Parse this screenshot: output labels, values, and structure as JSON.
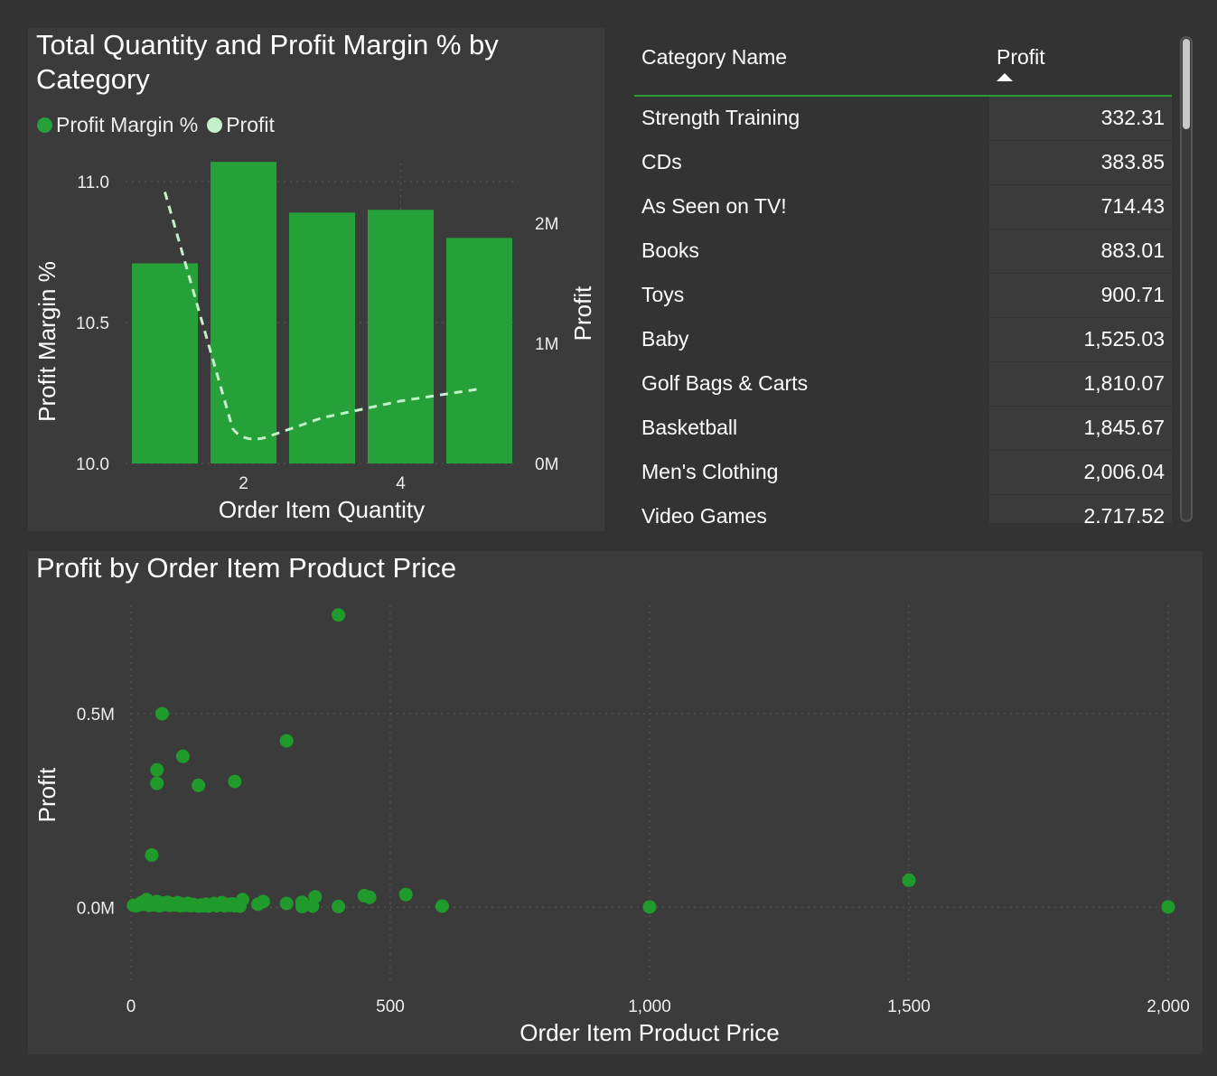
{
  "combo": {
    "title": "Total Quantity and Profit Margin % by Category",
    "legend": [
      {
        "label": "Profit Margin %",
        "color": "#26a038"
      },
      {
        "label": "Profit",
        "color": "#c4f0cc"
      }
    ],
    "chart_data": {
      "type": "bar",
      "title": "Total Quantity and Profit Margin % by Category",
      "xlabel": "Order Item Quantity",
      "ylabel": "Profit Margin %",
      "y2label": "Profit",
      "x": [
        1,
        2,
        3,
        4,
        5
      ],
      "x_ticks": [
        "2",
        "4"
      ],
      "y_ticks": [
        "10.0",
        "10.5",
        "11.0"
      ],
      "y2_ticks": [
        "0M",
        "1M",
        "2M"
      ],
      "ylim": [
        10.0,
        11.0
      ],
      "y2lim": [
        0,
        2000000
      ],
      "series": [
        {
          "name": "Profit Margin %",
          "type": "bar",
          "axis": "left",
          "values": [
            10.71,
            11.07,
            10.89,
            10.9,
            10.8
          ]
        },
        {
          "name": "Profit",
          "type": "line",
          "axis": "right",
          "values": [
            2260000,
            200000,
            380000,
            520000,
            620000
          ]
        }
      ]
    }
  },
  "table": {
    "headers": {
      "category": "Category Name",
      "profit": "Profit"
    },
    "rows": [
      {
        "category": "Strength Training",
        "profit": "332.31"
      },
      {
        "category": "CDs",
        "profit": "383.85"
      },
      {
        "category": "As Seen on TV!",
        "profit": "714.43"
      },
      {
        "category": "Books",
        "profit": "883.01"
      },
      {
        "category": "Toys",
        "profit": "900.71"
      },
      {
        "category": "Baby",
        "profit": "1,525.03"
      },
      {
        "category": "Golf Bags & Carts",
        "profit": "1,810.07"
      },
      {
        "category": "Basketball",
        "profit": "1,845.67"
      },
      {
        "category": "Men's Clothing",
        "profit": "2,006.04"
      },
      {
        "category": "Video Games",
        "profit": "2,717.52"
      }
    ]
  },
  "scatter": {
    "title": "Profit by Order Item Product Price",
    "chart_data": {
      "type": "scatter",
      "title": "Profit by Order Item Product Price",
      "xlabel": "Order Item Product Price",
      "ylabel": "Profit",
      "x_ticks": [
        "0",
        "500",
        "1,000",
        "1,500",
        "2,000"
      ],
      "y_ticks": [
        "0.0M",
        "0.5M"
      ],
      "xlim": [
        0,
        2000
      ],
      "ylim": [
        -0.2,
        0.78
      ],
      "color": "#1f9a2b",
      "points": [
        {
          "x": 400,
          "y": 0.755
        },
        {
          "x": 60,
          "y": 0.5
        },
        {
          "x": 300,
          "y": 0.43
        },
        {
          "x": 100,
          "y": 0.39
        },
        {
          "x": 50,
          "y": 0.355
        },
        {
          "x": 50,
          "y": 0.32
        },
        {
          "x": 130,
          "y": 0.315
        },
        {
          "x": 200,
          "y": 0.325
        },
        {
          "x": 40,
          "y": 0.135
        },
        {
          "x": 1500,
          "y": 0.07
        },
        {
          "x": 530,
          "y": 0.033
        },
        {
          "x": 450,
          "y": 0.03
        },
        {
          "x": 460,
          "y": 0.026
        },
        {
          "x": 355,
          "y": 0.027
        },
        {
          "x": 330,
          "y": 0.013
        },
        {
          "x": 300,
          "y": 0.01
        },
        {
          "x": 255,
          "y": 0.015
        },
        {
          "x": 245,
          "y": 0.008
        },
        {
          "x": 215,
          "y": 0.02
        },
        {
          "x": 600,
          "y": 0.003
        },
        {
          "x": 400,
          "y": 0.002
        },
        {
          "x": 350,
          "y": 0.003
        },
        {
          "x": 330,
          "y": 0.002
        },
        {
          "x": 1000,
          "y": 0.001
        },
        {
          "x": 2000,
          "y": 0.001
        },
        {
          "x": 5,
          "y": 0.005
        },
        {
          "x": 10,
          "y": 0.004
        },
        {
          "x": 15,
          "y": 0.006
        },
        {
          "x": 20,
          "y": 0.012
        },
        {
          "x": 25,
          "y": 0.008
        },
        {
          "x": 30,
          "y": 0.02
        },
        {
          "x": 35,
          "y": 0.005
        },
        {
          "x": 40,
          "y": 0.01
        },
        {
          "x": 45,
          "y": 0.006
        },
        {
          "x": 50,
          "y": 0.015
        },
        {
          "x": 55,
          "y": 0.004
        },
        {
          "x": 60,
          "y": 0.011
        },
        {
          "x": 65,
          "y": 0.007
        },
        {
          "x": 70,
          "y": 0.013
        },
        {
          "x": 75,
          "y": 0.005
        },
        {
          "x": 80,
          "y": 0.009
        },
        {
          "x": 85,
          "y": 0.006
        },
        {
          "x": 90,
          "y": 0.012
        },
        {
          "x": 95,
          "y": 0.004
        },
        {
          "x": 100,
          "y": 0.008
        },
        {
          "x": 105,
          "y": 0.005
        },
        {
          "x": 110,
          "y": 0.01
        },
        {
          "x": 115,
          "y": 0.004
        },
        {
          "x": 120,
          "y": 0.007
        },
        {
          "x": 125,
          "y": 0.005
        },
        {
          "x": 130,
          "y": 0.003
        },
        {
          "x": 135,
          "y": 0.006
        },
        {
          "x": 140,
          "y": 0.004
        },
        {
          "x": 145,
          "y": 0.008
        },
        {
          "x": 150,
          "y": 0.003
        },
        {
          "x": 160,
          "y": 0.01
        },
        {
          "x": 165,
          "y": 0.004
        },
        {
          "x": 170,
          "y": 0.006
        },
        {
          "x": 175,
          "y": 0.012
        },
        {
          "x": 180,
          "y": 0.004
        },
        {
          "x": 185,
          "y": 0.007
        },
        {
          "x": 190,
          "y": 0.005
        },
        {
          "x": 195,
          "y": 0.009
        },
        {
          "x": 200,
          "y": 0.004
        },
        {
          "x": 205,
          "y": 0.006
        },
        {
          "x": 210,
          "y": 0.003
        }
      ]
    }
  }
}
